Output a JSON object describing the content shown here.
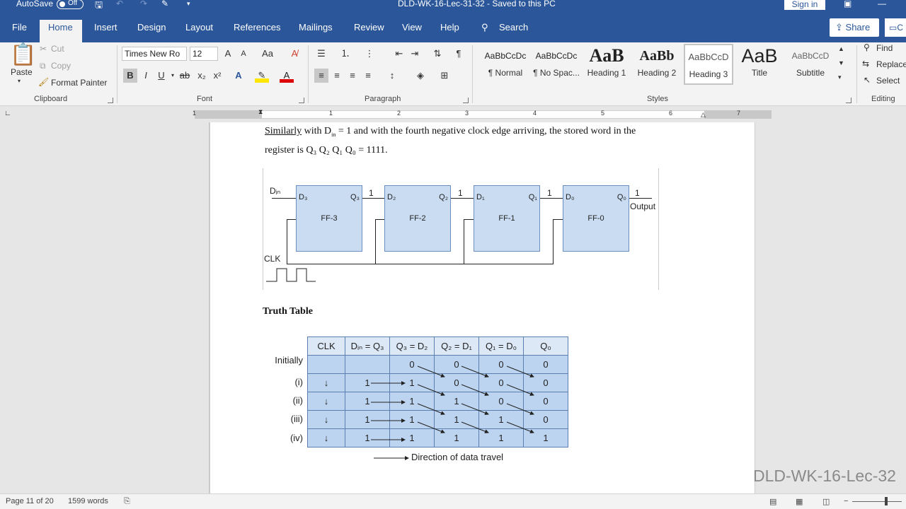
{
  "titlebar": {
    "autosave": "AutoSave",
    "autosave_state": "Off",
    "doc_title": "DLD-WK-16-Lec-31-32  -  Saved to this PC",
    "sign_in": "Sign in"
  },
  "tabs": [
    "File",
    "Home",
    "Insert",
    "Design",
    "Layout",
    "References",
    "Mailings",
    "Review",
    "View",
    "Help"
  ],
  "search": "Search",
  "share": "Share",
  "comments_partial": "C",
  "clipboard": {
    "paste": "Paste",
    "cut": "Cut",
    "copy": "Copy",
    "format_painter": "Format Painter",
    "label": "Clipboard"
  },
  "font": {
    "name": "Times New Ro",
    "size": "12",
    "grow": "A",
    "shrink": "A",
    "case": "Aa",
    "bold": "B",
    "italic": "I",
    "underline": "U",
    "strike": "ab",
    "label": "Font"
  },
  "paragraph": {
    "label": "Paragraph"
  },
  "styles": {
    "label": "Styles",
    "items": [
      {
        "preview": "AaBbCcDc",
        "name": "¶ Normal"
      },
      {
        "preview": "AaBbCcDc",
        "name": "¶ No Spac..."
      },
      {
        "preview": "AaB",
        "name": "Heading 1"
      },
      {
        "preview": "AaBb",
        "name": "Heading 2"
      },
      {
        "preview": "AaBbCcD",
        "name": "Heading 3"
      },
      {
        "preview": "AaB",
        "name": "Title"
      },
      {
        "preview": "AaBbCcD",
        "name": "Subtitle"
      }
    ]
  },
  "editing": {
    "find": "Find",
    "replace": "Replace",
    "select": "Select",
    "label": "Editing"
  },
  "ruler_numbers": [
    "1",
    "1",
    "2",
    "3",
    "4",
    "5",
    "6",
    "7"
  ],
  "document": {
    "line1_word": "Similarly",
    "line1_a": " with D",
    "line1_sub": "in",
    "line1_b": " = 1 and with the fourth negative clock edge arriving, the stored word in the",
    "line2": "register is Q₃ Q₂ Q₁ Q₀ = 1111.",
    "diagram": {
      "din": "Dᵢₙ",
      "clk": "CLK",
      "output": "Output",
      "ffs": [
        {
          "name": "FF-3",
          "d": "D₃",
          "q": "Q₃"
        },
        {
          "name": "FF-2",
          "d": "D₂",
          "q": "Q₂"
        },
        {
          "name": "FF-1",
          "d": "D₁",
          "q": "Q₁"
        },
        {
          "name": "FF-0",
          "d": "D₀",
          "q": "Q₀"
        }
      ],
      "link_values": [
        "1",
        "1",
        "1",
        "1"
      ]
    },
    "truth_table_heading": "Truth Table",
    "truth_table": {
      "headers": [
        "CLK",
        "Dᵢₙ = Q₃",
        "Q₃ = D₂",
        "Q₂ = D₁",
        "Q₁ = D₀",
        "Q₀"
      ],
      "row_labels": [
        "Initially",
        "(i)",
        "(ii)",
        "(iii)",
        "(iv)"
      ],
      "rows": [
        [
          "",
          "",
          "0",
          "0",
          "0",
          "0"
        ],
        [
          "↓",
          "1",
          "1",
          "0",
          "0",
          "0"
        ],
        [
          "↓",
          "1",
          "1",
          "1",
          "0",
          "0"
        ],
        [
          "↓",
          "1",
          "1",
          "1",
          "1",
          "0"
        ],
        [
          "↓",
          "1",
          "1",
          "1",
          "1",
          "1"
        ]
      ]
    },
    "direction_caption": "Direction of data travel"
  },
  "watermark": "DLD-WK-16-Lec-32",
  "status": {
    "page": "Page 11 of 20",
    "words": "1599 words"
  }
}
